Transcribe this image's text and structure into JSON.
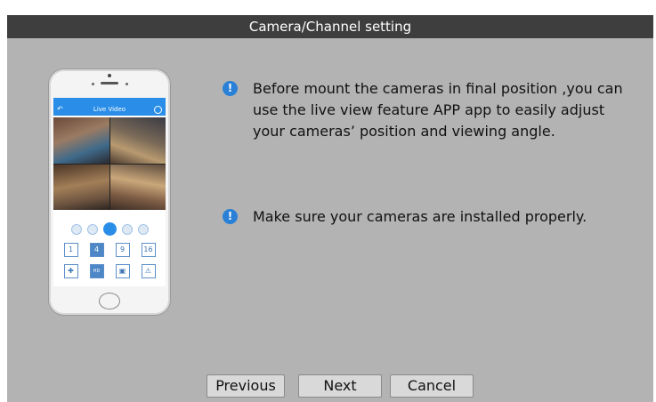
{
  "window": {
    "title": "Camera/Channel setting"
  },
  "phone": {
    "app_title": "Live Video",
    "split_buttons": [
      "1",
      "4",
      "9",
      "16"
    ],
    "bottom_icons": [
      "move-icon",
      "hd-icon",
      "record-icon",
      "alarm-icon"
    ]
  },
  "messages": [
    {
      "icon": "info-icon",
      "text": "Before mount the cameras in final position ,you can use the live view feature APP app to easily adjust your cameras’ position and viewing angle."
    },
    {
      "icon": "info-icon",
      "text": "Make sure your cameras are installed properly."
    }
  ],
  "footer": {
    "previous_label": "Previous",
    "next_label": "Next",
    "cancel_label": "Cancel"
  },
  "colors": {
    "background": "#b3b3b3",
    "titlebar": "#3e3e3e",
    "info_icon": "#2a80d6",
    "app_accent": "#2a8ee8"
  }
}
